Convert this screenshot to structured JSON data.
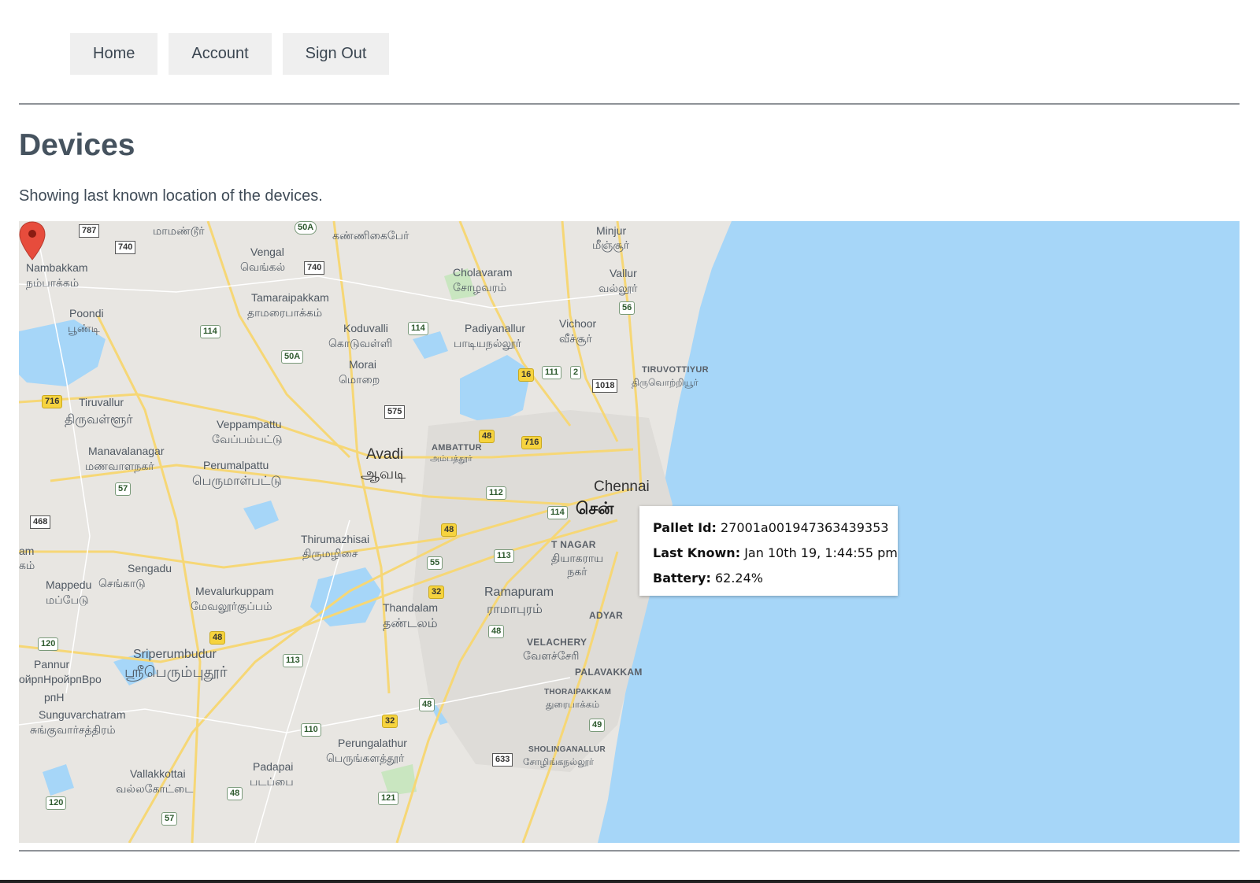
{
  "nav": {
    "home": "Home",
    "account": "Account",
    "sign_out": "Sign Out"
  },
  "page": {
    "title": "Devices",
    "subtitle": "Showing last known location of the devices."
  },
  "map": {
    "colors": {
      "land": "#e8e6e2",
      "water": "#a6d6f8",
      "road": "#f6d776",
      "park": "#c9e6c0"
    },
    "labels": {
      "minjur": "Minjur",
      "minjur_ta": "மீஞ்சூர்",
      "kannigaipair_ta": "கண்ணிகைபேர்",
      "mamandur_ta": "மாமண்டூர்",
      "vengal": "Vengal",
      "vengal_ta": "வெங்கல்",
      "nambakkam": "Nambakkam",
      "nambakkam_ta": "நம்பாக்கம்",
      "cholavaram": "Cholavaram",
      "cholavaram_ta": "சோழவரம்",
      "vallur": "Vallur",
      "vallur_ta": "வல்லூர்",
      "tamaraipakkam": "Tamaraipakkam",
      "tamaraipakkam_ta": "தாமரைபாக்கம்",
      "poondi": "Poondi",
      "poondi_ta": "பூண்டி",
      "koduvalli": "Koduvalli",
      "koduvalli_ta": "கொடுவள்ளி",
      "padiyanallur": "Padiyanallur",
      "padiyanallur_ta": "பாடியநல்லூர்",
      "vichoor": "Vichoor",
      "vichoor_ta": "வீச்சூர்",
      "morai": "Morai",
      "morai_ta": "மொறை",
      "tiruvottiyur": "TIRUVOTTIYUR",
      "tiruvottiyur_ta": "திருவொற்றியூர்",
      "tiruvallur": "Tiruvallur",
      "tiruvallur_ta": "திருவள்ளூர்",
      "veppampattu": "Veppampattu",
      "veppampattu_ta": "வேப்பம்பட்டு",
      "avadi": "Avadi",
      "avadi_ta": "ஆவடி",
      "ambattur": "AMBATTUR",
      "ambattur_ta": "அம்பத்தூர்",
      "manavalanagar": "Manavalanagar",
      "manavalanagar_ta": "மணவாளநகர்",
      "perumalpattu": "Perumalpattu",
      "perumalpattu_ta": "பெருமாள்பட்டு",
      "chennai": "Chennai",
      "chennai_ta": "சென்",
      "thirumazhisai": "Thirumazhisai",
      "thirumazhisai_ta": "திருமழிசை",
      "tnagar": "T NAGAR",
      "tnagar_ta": "தியாகராய நகர்",
      "am": "am",
      "kam": "கம்",
      "sengadu": "Sengadu",
      "sengadu_ta": "செங்காடு",
      "mappedu": "Mappedu",
      "mappedu_ta": "மப்பேடு",
      "mevalurkuppam": "Mevalurkuppam",
      "mevalurkuppam_ta": "மேவலூர்குப்பம்",
      "ramapuram": "Ramapuram",
      "ramapuram_ta": "ராமாபுரம்",
      "thandalam": "Thandalam",
      "thandalam_ta": "தண்டலம்",
      "adyar": "ADYAR",
      "velachery": "VELACHERY",
      "velachery_ta": "வேளச்சேரி",
      "sriperumbudur": "Sriperumbudur",
      "sriperumbudur_ta": "ஸ்ரீபெரும்புதூர்",
      "pannur": "Pannur",
      "pannur_ta": "ойрпНройрпВро",
      "pannur_ta2": "рпН",
      "palavakkam": "PALAVAKKAM",
      "thoraipakkam": "THORAIPAKKAM",
      "thoraipakkam_ta": "துரைபாக்கம்",
      "sunguvarchatram": "Sunguvarchatram",
      "sunguvarchatram_ta": "சுங்குவார்சத்திரம்",
      "perungalathur": "Perungalathur",
      "perungalathur_ta": "பெருங்களத்தூர்",
      "sholinganallur": "SHOLINGANALLUR",
      "sholinganallur_ta": "சோழிங்கநல்லூர்",
      "vallakkottai": "Vallakkottai",
      "vallakkottai_ta": "வல்லகோட்டை",
      "padapai": "Padapai",
      "padapai_ta": "படப்பை"
    },
    "shields": [
      "787",
      "740",
      "50A",
      "740",
      "114",
      "114",
      "50A",
      "16",
      "111",
      "2",
      "56",
      "1018",
      "716",
      "575",
      "48",
      "716",
      "57",
      "112",
      "114",
      "468",
      "48",
      "113",
      "55",
      "32",
      "48",
      "48",
      "120",
      "113",
      "48",
      "32",
      "110",
      "49",
      "633",
      "48",
      "120",
      "57",
      "121"
    ]
  },
  "device_popup": {
    "pallet_label": "Pallet Id:",
    "pallet_value": "27001a001947363439353",
    "last_known_label": "Last Known:",
    "last_known_value": "Jan 10th 19, 1:44:55 pm",
    "battery_label": "Battery:",
    "battery_value": "62.24%"
  }
}
